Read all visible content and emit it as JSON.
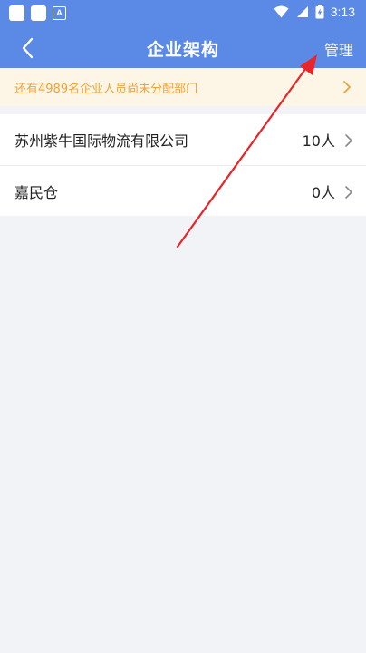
{
  "status_bar": {
    "time": "3:13",
    "left_icons": [
      "notification-square",
      "notification-square",
      "text-input-a"
    ],
    "a_glyph": "A",
    "right_icons": [
      "wifi-icon",
      "signal-icon",
      "battery-charging-icon"
    ]
  },
  "nav": {
    "back_icon": "chevron-left-icon",
    "title": "企业架构",
    "manage_label": "管理"
  },
  "notice": {
    "text": "还有4989名企业人员尚未分配部门",
    "icon": "chevron-right-icon"
  },
  "departments": [
    {
      "name": "苏州紫牛国际物流有限公司",
      "count": "10人"
    },
    {
      "name": "嘉民仓",
      "count": "0人"
    }
  ],
  "colors": {
    "header": "#5b8ae6",
    "notice_bg": "#fdf6e6",
    "notice_text": "#f0a23a",
    "page_bg": "#f2f3f7",
    "annotation_arrow": "#e8262a"
  }
}
